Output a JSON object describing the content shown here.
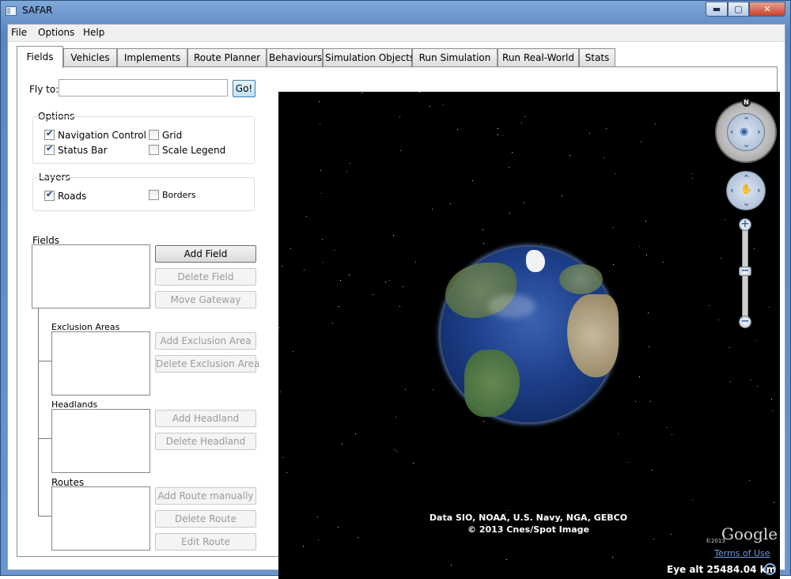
{
  "window": {
    "title": "SAFAR",
    "min_label": "▬",
    "max_label": "▢",
    "close_label": "✕"
  },
  "menu": [
    "File",
    "Options",
    "Help"
  ],
  "tabs": [
    "Fields",
    "Vehicles",
    "Implements",
    "Route Planner",
    "Behaviours",
    "Simulation Objects",
    "Run Simulation",
    "Run Real-World",
    "Stats"
  ],
  "fly_to": {
    "label": "Fly to:",
    "value": "",
    "button": "Go!"
  },
  "options": {
    "title": "Options",
    "items": [
      {
        "label": "Navigation Control",
        "checked": true
      },
      {
        "label": "Grid",
        "checked": false
      },
      {
        "label": "Status Bar",
        "checked": true
      },
      {
        "label": "Scale Legend",
        "checked": false
      }
    ]
  },
  "layers": {
    "title": "Layers",
    "items": [
      {
        "label": "Roads",
        "checked": true
      },
      {
        "label": "Borders",
        "checked": false
      }
    ]
  },
  "fields": {
    "label": "Fields",
    "add": "Add Field",
    "delete": "Delete Field",
    "move": "Move Gateway",
    "exclusion_label": "Exclusion Areas",
    "add_exclusion": "Add Exclusion Area",
    "delete_exclusion": "Delete Exclusion Area",
    "headlands_label": "Headlands",
    "add_headland": "Add Headland",
    "delete_headland": "Delete Headland",
    "routes_label": "Routes",
    "add_route": "Add Route manually",
    "delete_route": "Delete Route",
    "edit_route": "Edit Route"
  },
  "map": {
    "credit_line1": "Data SIO, NOAA, U.S. Navy, NGA, GEBCO",
    "credit_line2": "© 2013 Cnes/Spot Image",
    "google_small": "©2013",
    "google_logo": "Google",
    "terms": "Terms of Use",
    "eye_alt": "Eye alt 25484.04 km",
    "north": "N"
  }
}
